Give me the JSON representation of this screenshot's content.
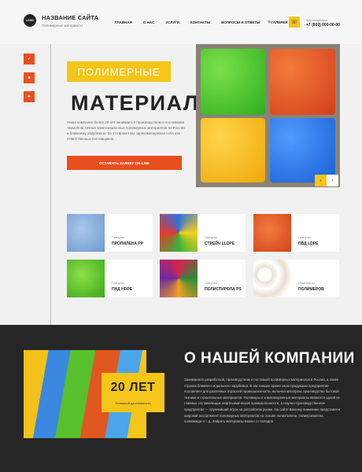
{
  "header": {
    "logo": "LOGO",
    "site_name": "НАЗВАНИЕ САЙТА",
    "tagline": "Полимерные материалы",
    "nav": [
      "ГЛАВНАЯ",
      "О НАС",
      "УСЛУГИ",
      "КОНТАКТЫ",
      "ВОПРОСЫ И ОТВЕТЫ",
      "ГАЛЕРЕЯ"
    ],
    "menu_icon": "≡",
    "phone_icon": "☏",
    "phone_label": "Круглосуточно",
    "phone_number": "+7 (000) 000-00-00"
  },
  "social": [
    {
      "icon": "vk-icon",
      "glyph": "✓"
    },
    {
      "icon": "ok-icon",
      "glyph": "☻"
    },
    {
      "icon": "telegram-icon",
      "glyph": "✈"
    }
  ],
  "hero": {
    "tag": "ПОЛИМЕРНЫЕ",
    "title": "МАТЕРИАЛЫ",
    "text": "Наша компания более 20 лет занимается производством и поставками термопластичных композиционных полимерных материалов по России и ближнему зарубежью. За это время мы зарекомендовали себя как ответственных поставщиков.",
    "cta": "ОСТАВИТЬ ЗАЯВКУ ON-LINE",
    "prev": "‹",
    "next": "›"
  },
  "products": [
    {
      "category": "Гранулы",
      "name": "ПРОПИЛЕНА PP",
      "color": "#7aa7d6"
    },
    {
      "category": "Гранулы",
      "name": "СТРЕЙЧ LLDPE",
      "color": "#3a7bd5"
    },
    {
      "category": "Гранулы",
      "name": "ПВД LDPE",
      "color": "#e0571f"
    },
    {
      "category": "Гранулы",
      "name": "ПНД HDPE",
      "color": "#5ec22a"
    },
    {
      "category": "Гранулы",
      "name": "ПОЛИСТИРОЛА PS",
      "color": "#c2245a"
    },
    {
      "category": "Изделия из",
      "name": "ПОЛИМЕРОВ",
      "color": "#f3efe8"
    }
  ],
  "about": {
    "title": "О НАШЕЙ КОМПАНИИ",
    "years": "20 ЛЕТ",
    "years_label": "Успешной деятельности",
    "text": "Занимаемся разработкой, производством и поставкой полимерных материалов в России, а также странах ближнего и дальнего зарубежья. В настоящее время свою продукцию предприятие поставляет для различных отраслей промышленности, включая автопром, производство бытовой техники и строительных материалов. Полимеры и композиционные материалы являются одной из главных составляющих нефтехимической промышленности, а Научно-производственное предприятие — крупнейший игрок на российском рынке. На сайте Вашему вниманию представлен широкий ассортимент полимерных материалов на основе полиэтилена, полипропилена, полиамида и т. д. Забрать материалы можно со складов."
  }
}
